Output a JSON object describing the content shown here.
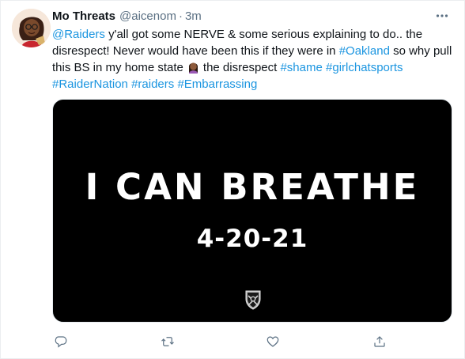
{
  "tweet": {
    "display_name": "Mo Threats",
    "handle": "@aicenom",
    "separator": "·",
    "time": "3m",
    "text": {
      "line1": {
        "mention": "@Raiders",
        "rest": " y'all got some NERVE & some serious explaining to do.. the"
      },
      "line2": {
        "before": "disrespect! Never would have been this if they were in ",
        "hashtag": "#Oakland",
        "after": " so why pull"
      },
      "line3": {
        "before": "this BS in my home state",
        "emoji": "woman-facepalming-emoji",
        "middle": "the disrespect ",
        "hashtag1": "#shame",
        "space": " ",
        "hashtag2": "#girlchatsports"
      },
      "line4": {
        "hashtag1": "#RaiderNation",
        "hashtag2": "#raiders",
        "hashtag3": "#Embarrassing"
      }
    },
    "media": {
      "headline": "I CAN BREATHE",
      "date": "4-20-21",
      "logo": "raiders-shield-logo"
    },
    "actions": {
      "reply_icon": "reply-icon",
      "retweet_icon": "retweet-icon",
      "like_icon": "heart-icon",
      "share_icon": "share-icon"
    },
    "colors": {
      "link": "#1b95e0",
      "muted": "#5b7083",
      "text": "#0f1419",
      "media_bg": "#000000"
    }
  }
}
